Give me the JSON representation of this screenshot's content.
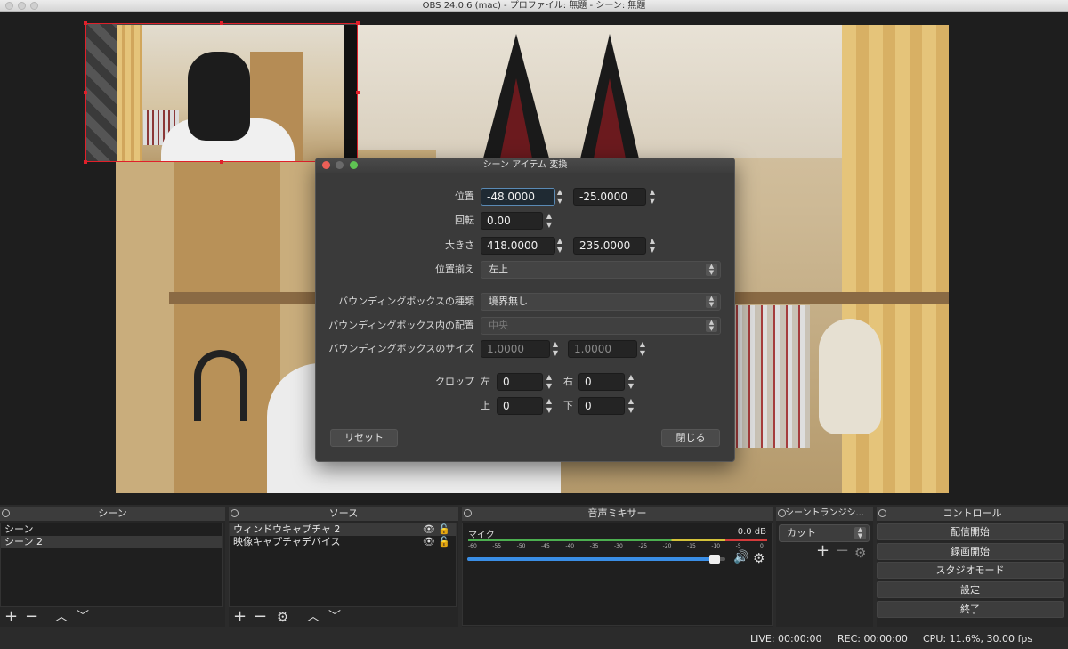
{
  "window": {
    "title": "OBS 24.0.6 (mac) - プロファイル: 無題 - シーン: 無題"
  },
  "dialog": {
    "title": "シーン アイテム 変換",
    "position_label": "位置",
    "position_x": "-48.0000",
    "position_y": "-25.0000",
    "rotation_label": "回転",
    "rotation": "0.00",
    "size_label": "大きさ",
    "size_w": "418.0000",
    "size_h": "235.0000",
    "alignment_label": "位置揃え",
    "alignment_value": "左上",
    "bbox_type_label": "バウンディングボックスの種類",
    "bbox_type_value": "境界無し",
    "bbox_align_label": "バウンディングボックス内の配置",
    "bbox_align_value": "中央",
    "bbox_size_label": "バウンディングボックスのサイズ",
    "bbox_w": "1.0000",
    "bbox_h": "1.0000",
    "crop_label": "クロップ",
    "crop_left_label": "左",
    "crop_left": "0",
    "crop_right_label": "右",
    "crop_right": "0",
    "crop_top_label": "上",
    "crop_top": "0",
    "crop_bottom_label": "下",
    "crop_bottom": "0",
    "reset_label": "リセット",
    "close_label": "閉じる"
  },
  "scenes": {
    "title": "シーン",
    "items": [
      {
        "label": "シーン"
      },
      {
        "label": "シーン 2"
      }
    ]
  },
  "sources": {
    "title": "ソース",
    "items": [
      {
        "label": "ウィンドウキャプチャ 2"
      },
      {
        "label": "映像キャプチャデバイス"
      }
    ]
  },
  "mixer": {
    "title": "音声ミキサー",
    "channel": "マイク",
    "level": "0.0 dB",
    "ticks": [
      "-60",
      "-55",
      "-50",
      "-45",
      "-40",
      "-35",
      "-30",
      "-25",
      "-20",
      "-15",
      "-10",
      "-5",
      "0"
    ],
    "volume_fraction": 0.98
  },
  "transitions": {
    "title": "シーントランジシ...",
    "value": "カット"
  },
  "controls": {
    "title": "コントロール",
    "buttons": [
      "配信開始",
      "録画開始",
      "スタジオモード",
      "設定",
      "終了"
    ]
  },
  "status": {
    "live": "LIVE: 00:00:00",
    "rec": "REC: 00:00:00",
    "cpu": "CPU: 11.6%, 30.00 fps"
  },
  "colors": {
    "selection_red": "#e0202a",
    "meter_green": "#4caf50",
    "meter_yellow": "#d4c23a",
    "meter_red": "#d33b3b",
    "volume_blue": "#3a8ee6"
  }
}
